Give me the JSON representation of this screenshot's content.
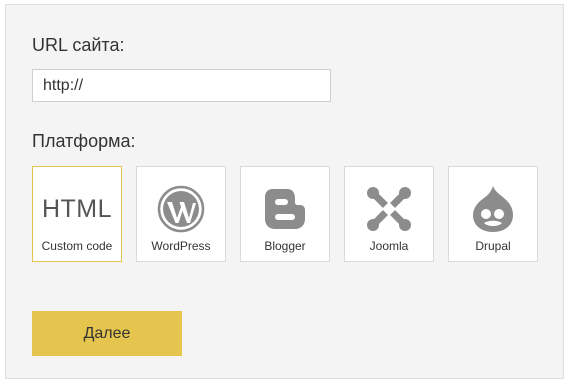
{
  "form": {
    "url_label": "URL сайта:",
    "url_value": "http://",
    "platform_label": "Платформа:",
    "next_label": "Далее"
  },
  "platforms": [
    {
      "name": "HTML",
      "caption": "Custom code",
      "icon": "html-text",
      "selected": true
    },
    {
      "name": "WordPress",
      "caption": "WordPress",
      "icon": "wordpress-icon",
      "selected": false
    },
    {
      "name": "Blogger",
      "caption": "Blogger",
      "icon": "blogger-icon",
      "selected": false
    },
    {
      "name": "Joomla",
      "caption": "Joomla",
      "icon": "joomla-icon",
      "selected": false
    },
    {
      "name": "Drupal",
      "caption": "Drupal",
      "icon": "drupal-icon",
      "selected": false
    }
  ],
  "colors": {
    "accent": "#e6c54e",
    "icon_gray": "#8c8c8c",
    "panel_bg": "#f4f4f4"
  }
}
